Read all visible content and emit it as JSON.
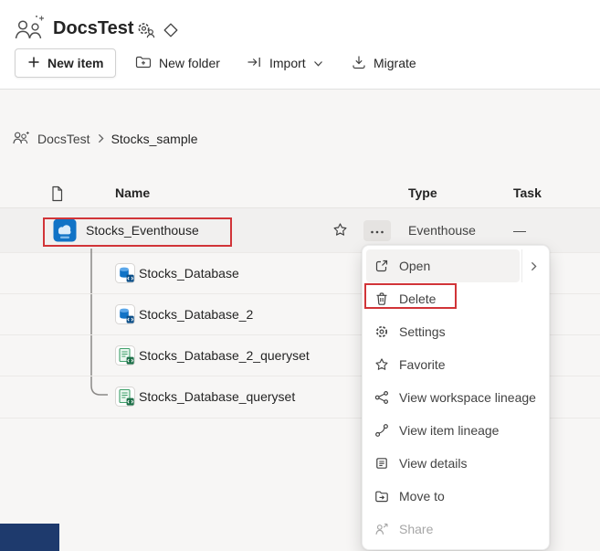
{
  "colors": {
    "annotation_red": "#d13438",
    "accent_blue": "#1173c6",
    "bottom_block_navy": "#1e3a6d"
  },
  "header": {
    "workspace_name": "DocsTest"
  },
  "toolbar": {
    "new_item_label": "New item",
    "new_folder_label": "New folder",
    "import_label": "Import",
    "migrate_label": "Migrate"
  },
  "breadcrumb": {
    "items": [
      {
        "label": "DocsTest"
      },
      {
        "label": "Stocks_sample"
      }
    ]
  },
  "table": {
    "columns": {
      "name": "Name",
      "type": "Type",
      "task": "Task"
    },
    "rows": [
      {
        "name": "Stocks_Eventhouse",
        "type": "Eventhouse",
        "task": "—",
        "icon": "eventhouse-icon",
        "annotated": true
      },
      {
        "name": "Stocks_Database",
        "icon": "kql-database-icon"
      },
      {
        "name": "Stocks_Database_2",
        "icon": "kql-database-icon"
      },
      {
        "name": "Stocks_Database_2_queryset",
        "icon": "kql-queryset-icon"
      },
      {
        "name": "Stocks_Database_queryset",
        "icon": "kql-queryset-icon"
      }
    ]
  },
  "context_menu": {
    "items": [
      {
        "label": "Open",
        "icon": "open-icon",
        "has_submenu": true,
        "highlighted": true
      },
      {
        "label": "Delete",
        "icon": "trash-icon",
        "annotated": true
      },
      {
        "label": "Settings",
        "icon": "gear-icon"
      },
      {
        "label": "Favorite",
        "icon": "star-icon"
      },
      {
        "label": "View workspace lineage",
        "icon": "workspace-lineage-icon"
      },
      {
        "label": "View item lineage",
        "icon": "item-lineage-icon"
      },
      {
        "label": "View details",
        "icon": "details-icon"
      },
      {
        "label": "Move to",
        "icon": "move-to-icon"
      },
      {
        "label": "Share",
        "icon": "share-icon",
        "disabled": true
      }
    ]
  }
}
